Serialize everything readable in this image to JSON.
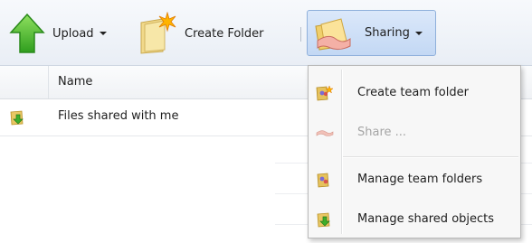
{
  "toolbar": {
    "upload_label": "Upload",
    "create_folder_label": "Create Folder",
    "sharing_label": "Sharing"
  },
  "grid": {
    "columns": [
      {
        "label": "Name"
      }
    ],
    "rows": [
      {
        "name": "Files shared with me",
        "icon": "shared-folder-icon"
      }
    ]
  },
  "sharing_menu": {
    "items": [
      {
        "label": "Create team folder",
        "icon": "team-folder-add-icon",
        "disabled": false
      },
      {
        "label": "Share ...",
        "icon": "share-icon",
        "disabled": true
      },
      {
        "label": "Manage team folders",
        "icon": "team-folder-icon",
        "disabled": false
      },
      {
        "label": "Manage shared objects",
        "icon": "shared-folder-icon",
        "disabled": false
      }
    ]
  },
  "colors": {
    "toolbar_bg": "#e9eef5",
    "active_button": "#c3d8f4",
    "disabled_text": "#a5a5a5",
    "upload_arrow": "#4fc22e"
  }
}
